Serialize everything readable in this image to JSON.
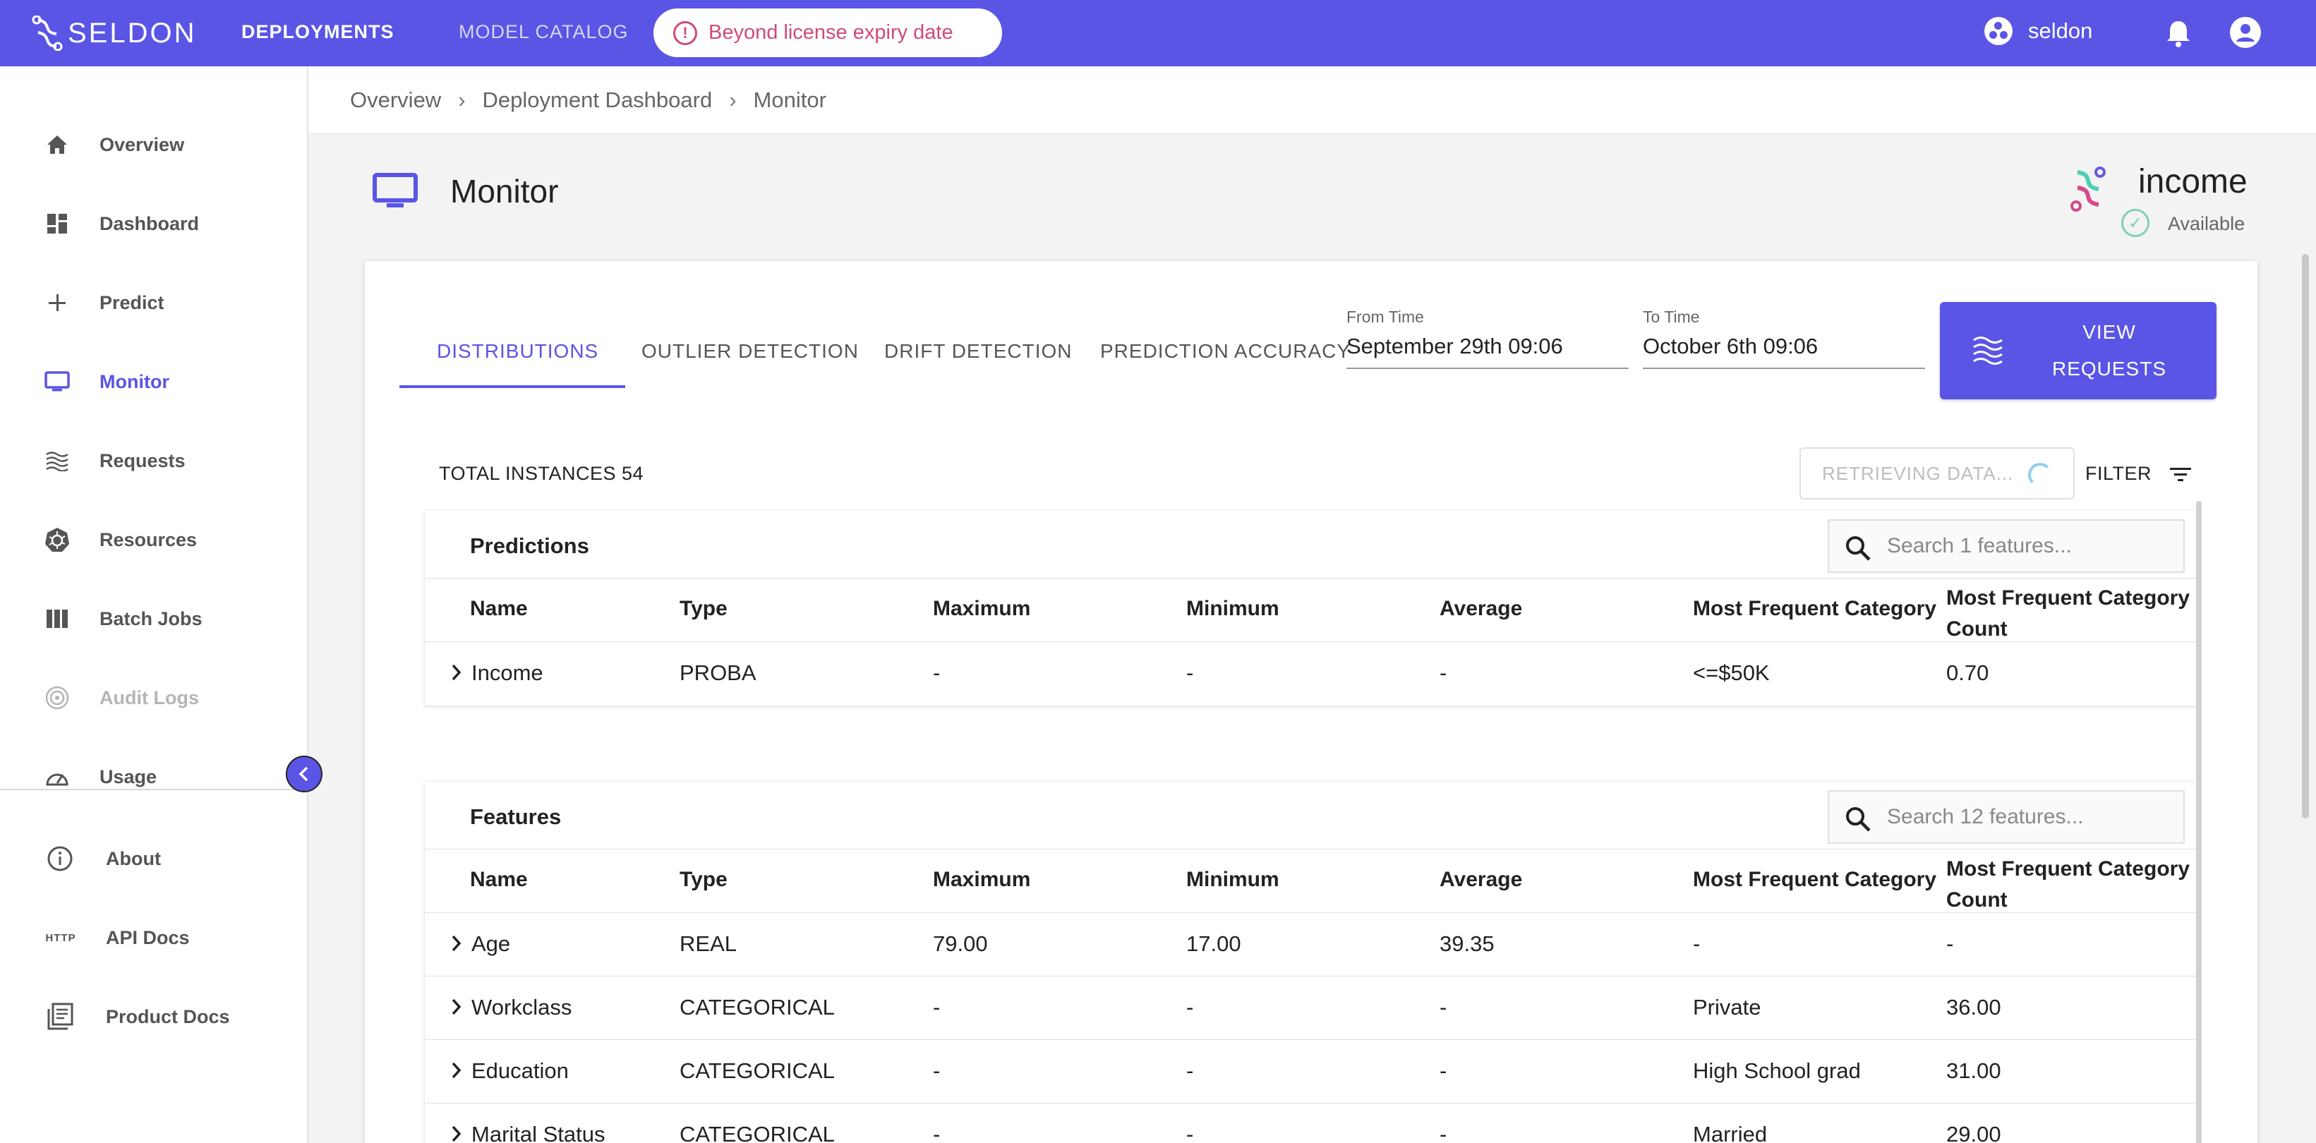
{
  "topbar": {
    "brand": "SELDON",
    "nav": {
      "deployments": "DEPLOYMENTS",
      "model_catalog": "MODEL CATALOG"
    },
    "license_warning": "Beyond license expiry date",
    "user": "seldon"
  },
  "sidebar": {
    "items": [
      {
        "label": "Overview",
        "icon": "home-icon"
      },
      {
        "label": "Dashboard",
        "icon": "dashboard-icon"
      },
      {
        "label": "Predict",
        "icon": "plus-icon"
      },
      {
        "label": "Monitor",
        "icon": "monitor-icon",
        "active": true
      },
      {
        "label": "Requests",
        "icon": "waves-icon"
      },
      {
        "label": "Resources",
        "icon": "kubernetes-icon"
      },
      {
        "label": "Batch Jobs",
        "icon": "columns-icon"
      },
      {
        "label": "Audit Logs",
        "icon": "fingerprint-icon",
        "disabled": true
      },
      {
        "label": "Usage",
        "icon": "speedometer-icon"
      }
    ],
    "lower_items": [
      {
        "label": "About",
        "icon": "info-icon"
      },
      {
        "label": "API Docs",
        "icon": "http-icon"
      },
      {
        "label": "Product Docs",
        "icon": "docs-icon"
      }
    ]
  },
  "breadcrumb": [
    "Overview",
    "Deployment Dashboard",
    "Monitor"
  ],
  "page": {
    "title": "Monitor",
    "model": {
      "name": "income",
      "status": "Available"
    }
  },
  "tabs": [
    "DISTRIBUTIONS",
    "OUTLIER DETECTION",
    "DRIFT DETECTION",
    "PREDICTION ACCURACY"
  ],
  "time_range": {
    "from_label": "From Time",
    "from_value": "September 29th 09:06",
    "to_label": "To Time",
    "to_value": "October 6th 09:06"
  },
  "view_requests": {
    "line1": "VIEW",
    "line2": "REQUESTS"
  },
  "summary": {
    "total_instances": "TOTAL INSTANCES 54",
    "retrieving": "RETRIEVING DATA...",
    "filter": "FILTER"
  },
  "columns": [
    "Name",
    "Type",
    "Maximum",
    "Minimum",
    "Average",
    "Most Frequent Category",
    "Most Frequent Category Count"
  ],
  "predictions": {
    "title": "Predictions",
    "search_placeholder": "Search 1 features...",
    "rows": [
      [
        "Income",
        "PROBA",
        "-",
        "-",
        "-",
        "<=$50K",
        "0.70"
      ]
    ]
  },
  "features": {
    "title": "Features",
    "search_placeholder": "Search 12 features...",
    "rows": [
      [
        "Age",
        "REAL",
        "79.00",
        "17.00",
        "39.35",
        "-",
        "-"
      ],
      [
        "Workclass",
        "CATEGORICAL",
        "-",
        "-",
        "-",
        "Private",
        "36.00"
      ],
      [
        "Education",
        "CATEGORICAL",
        "-",
        "-",
        "-",
        "High School grad",
        "31.00"
      ],
      [
        "Marital Status",
        "CATEGORICAL",
        "-",
        "-",
        "-",
        "Married",
        "29.00"
      ]
    ]
  }
}
